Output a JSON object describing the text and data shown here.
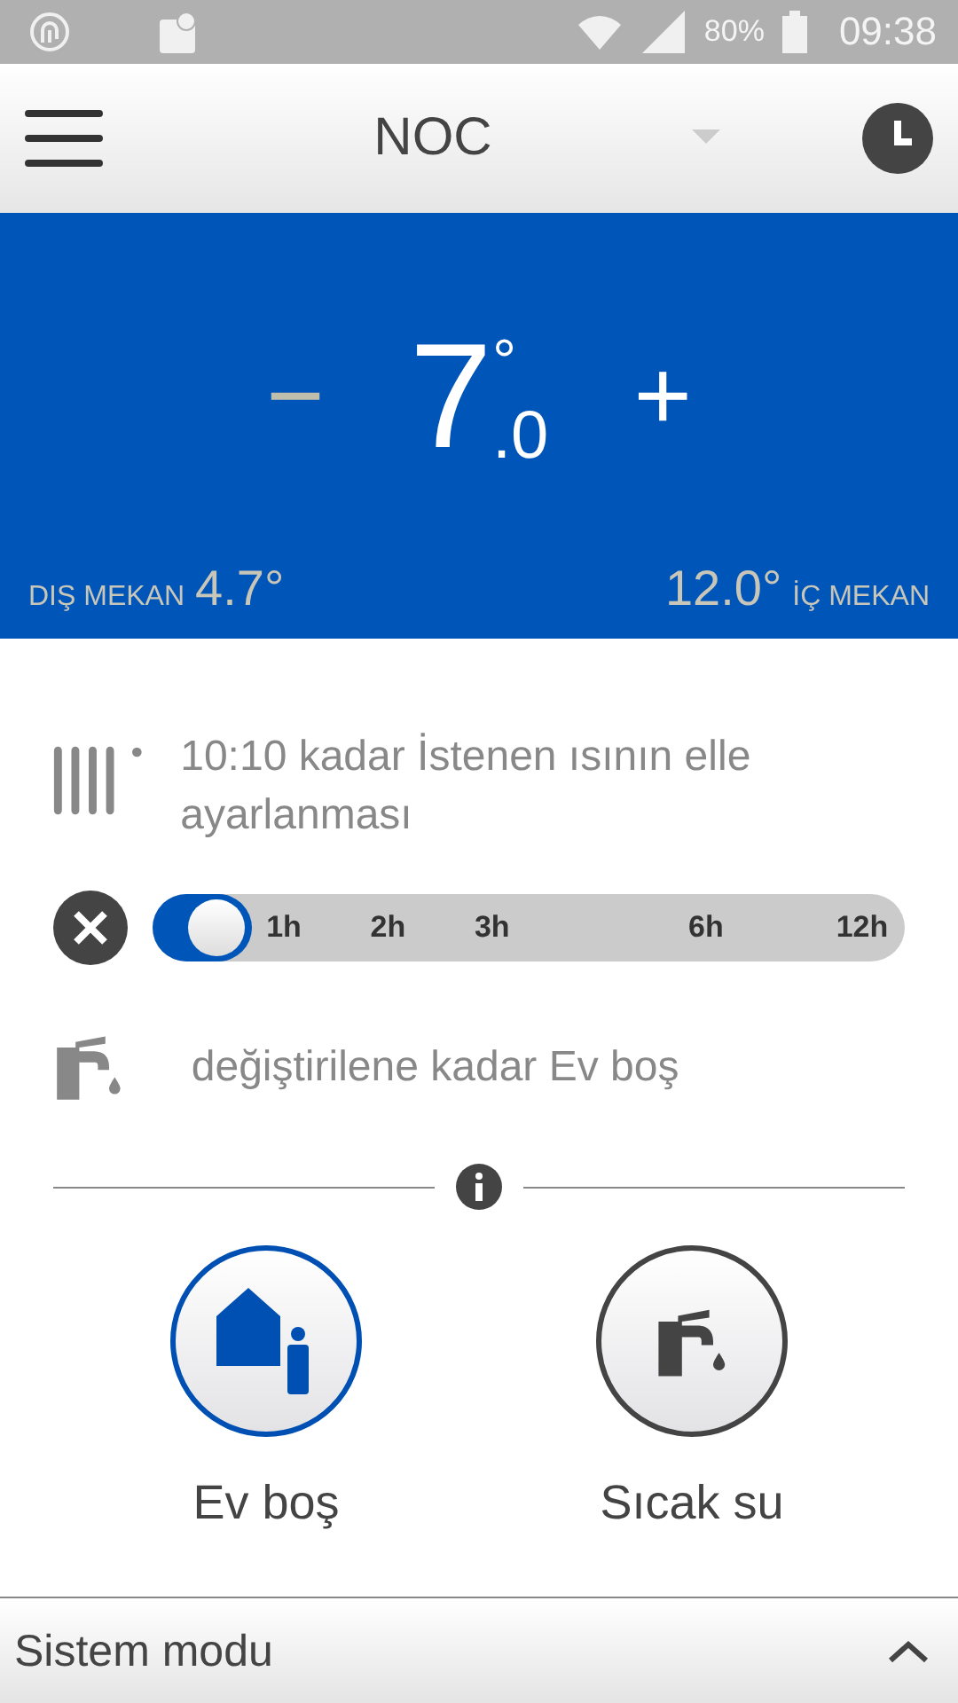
{
  "status_bar": {
    "battery": "80%",
    "time": "09:38"
  },
  "header": {
    "title": "NOC"
  },
  "setpoint": {
    "minus": "−",
    "minus_disabled": true,
    "whole": "7",
    "fraction": ".0",
    "degree": "°",
    "plus": "+",
    "plus_disabled": false
  },
  "outdoor": {
    "label": "DIŞ MEKAN",
    "value": "4.7°"
  },
  "indoor": {
    "value": "12.0°",
    "label": "İÇ MEKAN"
  },
  "heating_status": {
    "text": "10:10 kadar İstenen ısının elle ayarlanması"
  },
  "duration_slider": {
    "level": 0,
    "ticks": [
      "1h",
      "2h",
      "3h",
      "6h",
      "12h"
    ]
  },
  "water_status": {
    "text": "değiştirilene kadar Ev boş"
  },
  "modes": [
    {
      "kind": "away",
      "label": "Ev boş",
      "selected": true
    },
    {
      "kind": "hotwater",
      "label": "Sıcak su",
      "selected": false
    }
  ],
  "footer": {
    "title": "Sistem modu"
  }
}
